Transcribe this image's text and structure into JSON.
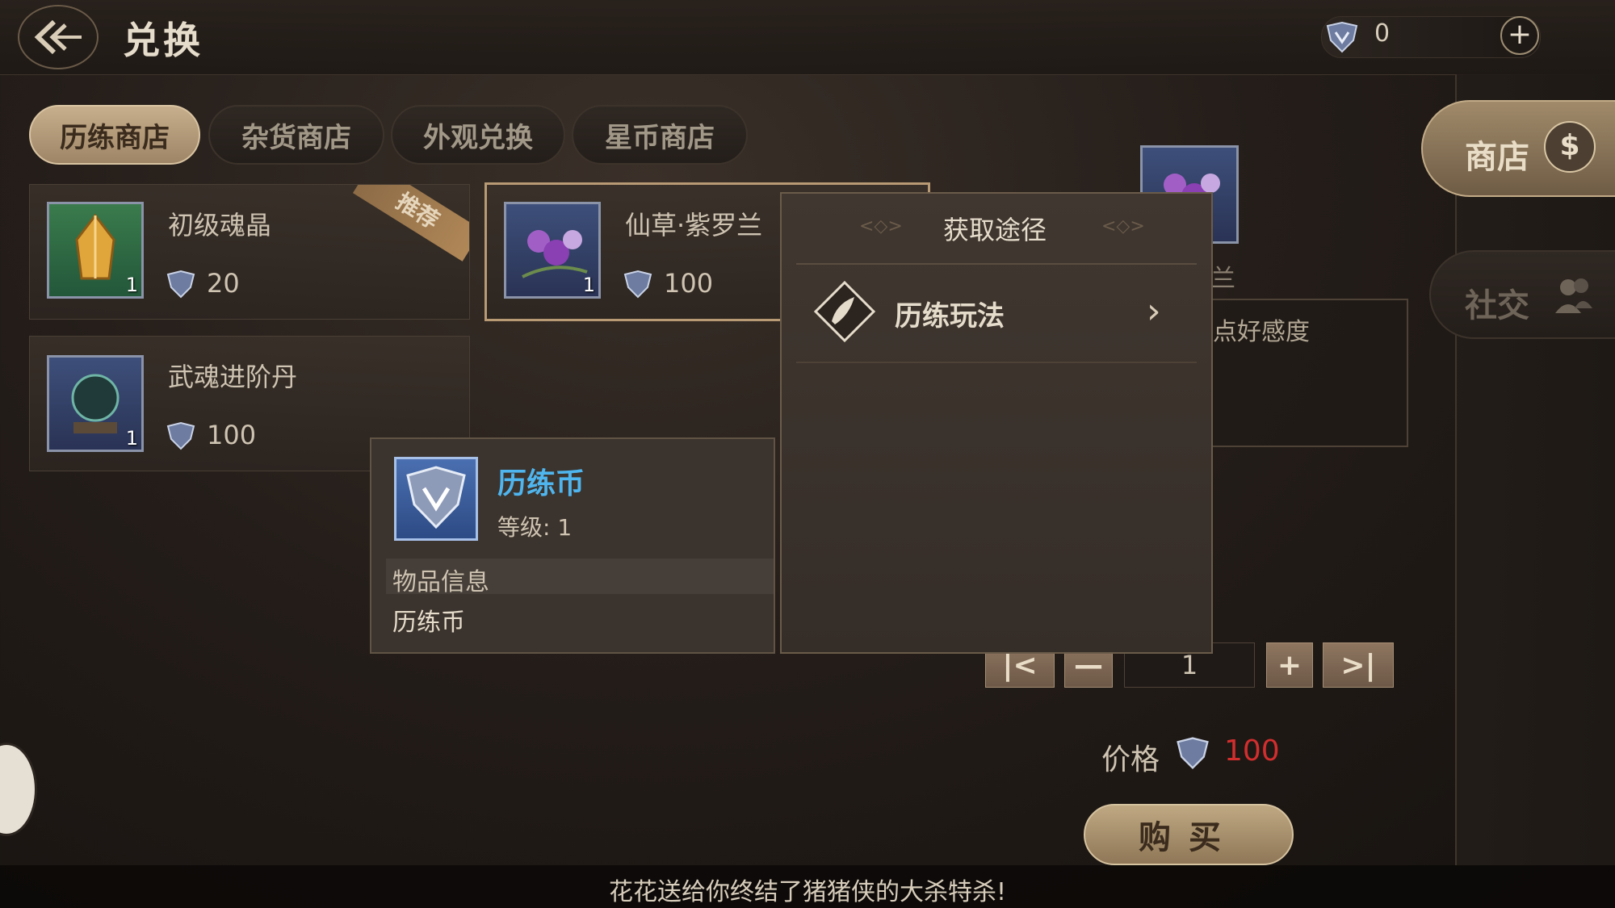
{
  "header": {
    "title": "兑换",
    "currency_value": "0"
  },
  "tabs": [
    {
      "label": "历练商店",
      "active": true
    },
    {
      "label": "杂货商店",
      "active": false
    },
    {
      "label": "外观兑换",
      "active": false
    },
    {
      "label": "星币商店",
      "active": false
    }
  ],
  "items": [
    {
      "name": "初级魂晶",
      "price": "20",
      "qty": "1",
      "badge": "推荐",
      "icon": "amber-crystal-icon"
    },
    {
      "name": "仙草·紫罗兰",
      "price": "100",
      "qty": "1",
      "icon": "violet-herb-icon"
    },
    {
      "name": "武魂进阶丹",
      "price": "100",
      "qty": "1",
      "icon": "dark-orb-pill-icon"
    }
  ],
  "tooltip": {
    "name": "历练币",
    "level": "等级: 1",
    "section": "物品信息",
    "description": "历练币"
  },
  "source_panel": {
    "title": "获取途径",
    "entries": [
      {
        "label": "历练玩法"
      }
    ]
  },
  "detail": {
    "name_partial": "罗兰",
    "desc_partial": "点好感度",
    "qty_value": "1"
  },
  "purchase": {
    "price_label": "价格",
    "price_value": "100",
    "buy_label": "购买"
  },
  "sidebar": {
    "shop_label": "商店",
    "social_label": "社交"
  },
  "marquee": {
    "text": "花花送给你终结了猪猪侠的大杀特杀!"
  },
  "colors": {
    "price_red": "#d22e2e",
    "tooltip_name_blue": "#4fb5ee",
    "tab_active": "#c7ae8c"
  }
}
